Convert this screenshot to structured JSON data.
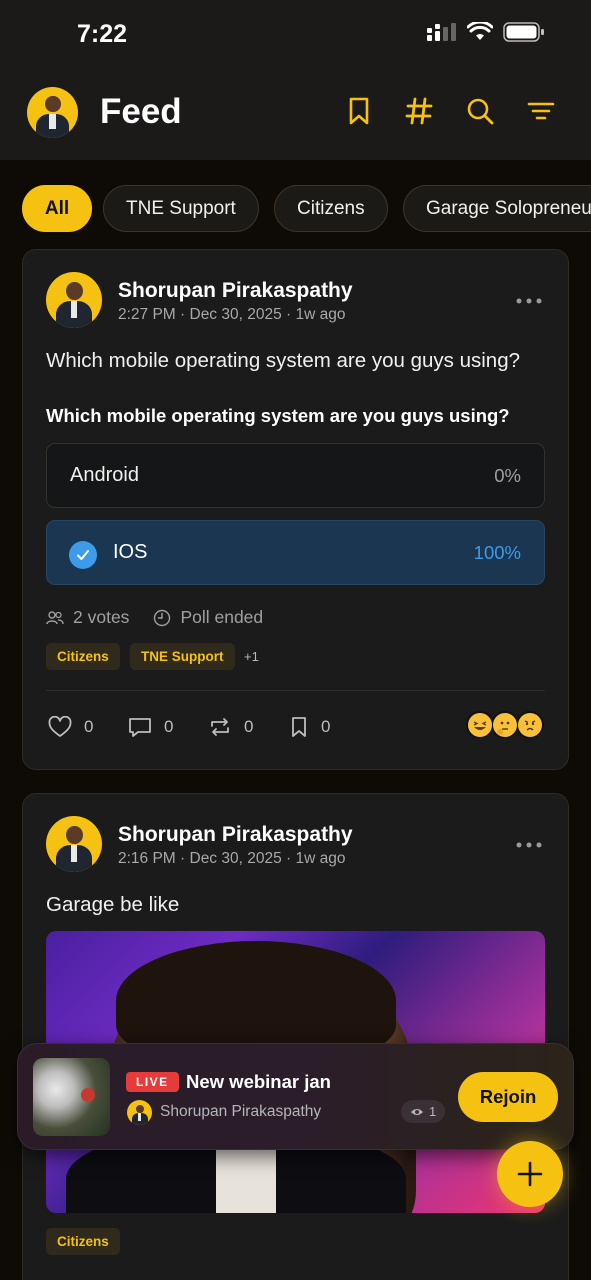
{
  "status_bar": {
    "time": "7:22"
  },
  "header": {
    "title": "Feed",
    "icons": [
      "bookmark-icon",
      "hashtag-icon",
      "search-icon",
      "filter-icon"
    ]
  },
  "accent_color": "#f5c211",
  "chips": [
    {
      "label": "All",
      "active": true
    },
    {
      "label": "TNE Support",
      "active": false
    },
    {
      "label": "Citizens",
      "active": false
    },
    {
      "label": "Garage Solopreneu",
      "active": false
    }
  ],
  "posts": [
    {
      "author": "Shorupan Pirakaspathy",
      "meta": "2:27 PM · Dec 30, 2025 · 1w ago",
      "text": "Which mobile operating system are you guys using?",
      "poll": {
        "question": "Which mobile operating system are you guys using?",
        "options": [
          {
            "label": "Android",
            "percent": "0%",
            "selected": false
          },
          {
            "label": "IOS",
            "percent": "100%",
            "selected": true
          }
        ],
        "votes": "2 votes",
        "status": "Poll ended"
      },
      "tags": [
        "Citizens",
        "TNE Support"
      ],
      "tags_more": "+1",
      "actions": {
        "likes": "0",
        "comments": "0",
        "reposts": "0",
        "saves": "0"
      },
      "reactions": [
        "laughing-emoji",
        "thinking-emoji",
        "pouting-emoji"
      ]
    },
    {
      "author": "Shorupan Pirakaspathy",
      "meta": "2:16 PM · Dec 30, 2025 · 1w ago",
      "text": "Garage be like",
      "tags": [
        "Citizens"
      ]
    }
  ],
  "live_banner": {
    "badge": "LIVE",
    "title": "New webinar jan",
    "host": "Shorupan Pirakaspathy",
    "viewers": "1",
    "button": "Rejoin"
  }
}
